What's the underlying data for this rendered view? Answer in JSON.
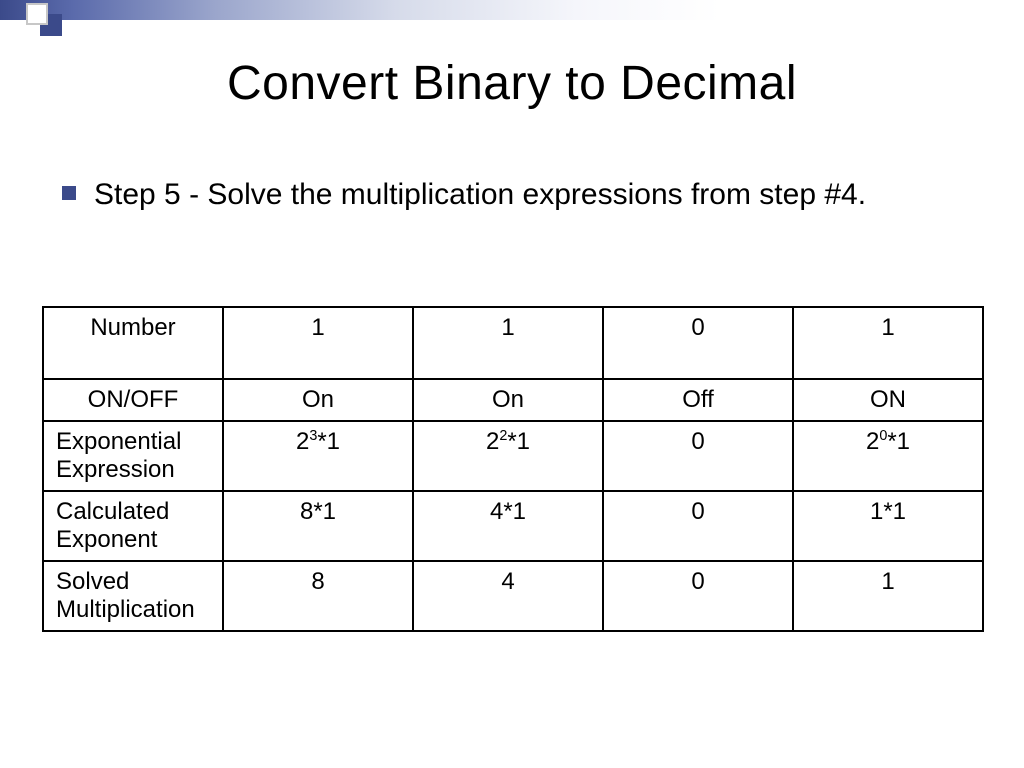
{
  "title": "Convert Binary to Decimal",
  "bullet": "Step 5 -  Solve the multiplication expressions from step #4.",
  "table": {
    "rows": [
      {
        "label": "Number",
        "cells": [
          "1",
          "1",
          "0",
          "1"
        ]
      },
      {
        "label": "ON/OFF",
        "cells": [
          "On",
          "On",
          "Off",
          "ON"
        ]
      },
      {
        "label_l1": "Exponential",
        "label_l2": "Expression",
        "cells": [
          {
            "exp": "3",
            "tail": "*1"
          },
          {
            "exp": "2",
            "tail": "*1"
          },
          {
            "plain": "0"
          },
          {
            "exp": "0",
            "tail": "*1"
          }
        ]
      },
      {
        "label_l1": "Calculated",
        "label_l2": "Exponent",
        "cells": [
          "8*1",
          "4*1",
          "0",
          "1*1"
        ]
      },
      {
        "label_l1": "Solved",
        "label_l2": "Multiplication",
        "cells": [
          "8",
          "4",
          "0",
          "1"
        ]
      }
    ]
  }
}
